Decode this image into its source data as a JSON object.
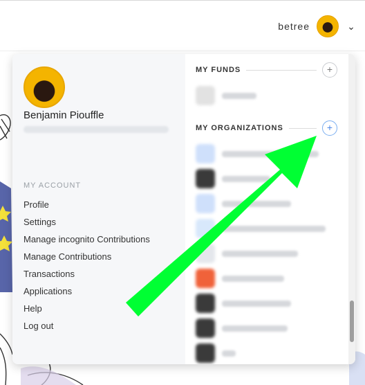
{
  "header": {
    "username": "betree",
    "avatar_icon": "user-avatar",
    "chevron_icon": "chevron-down-icon"
  },
  "profile": {
    "name": "Benjamin Piouffle"
  },
  "account": {
    "section_label": "MY ACCOUNT",
    "items": [
      {
        "label": "Profile"
      },
      {
        "label": "Settings"
      },
      {
        "label": "Manage incognito Contributions"
      },
      {
        "label": "Manage Contributions"
      },
      {
        "label": "Transactions"
      },
      {
        "label": "Applications"
      },
      {
        "label": "Help"
      },
      {
        "label": "Log out"
      }
    ]
  },
  "funds": {
    "title": "MY FUNDS",
    "add_label": "+"
  },
  "organizations": {
    "title": "MY ORGANIZATIONS",
    "add_label": "+"
  },
  "colors": {
    "annotation_arrow": "#00ff33",
    "add_highlight": "#4a86e8"
  }
}
